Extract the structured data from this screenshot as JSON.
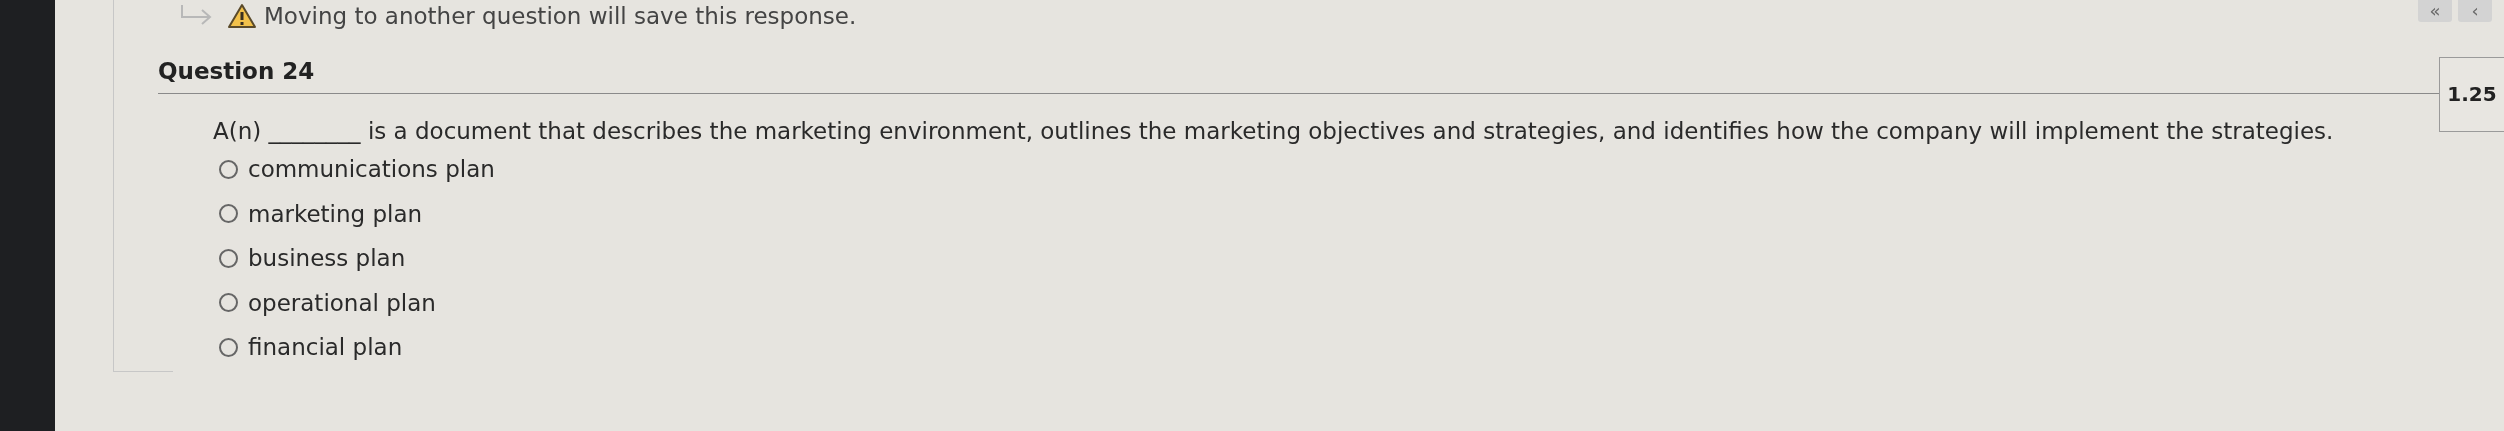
{
  "notice": "Moving to another question will save this response.",
  "nav_buttons": [
    "«",
    "‹"
  ],
  "question": {
    "title": "Question 24",
    "points": "1.25",
    "prompt": "A(n) ________ is a document that describes the marketing environment, outlines the marketing objectives and strategies, and identifies how the company will implement the strategies.",
    "options": [
      {
        "label": "communications plan",
        "selected": false
      },
      {
        "label": "marketing plan",
        "selected": false
      },
      {
        "label": "business plan",
        "selected": false
      },
      {
        "label": "operational plan",
        "selected": false
      },
      {
        "label": "financial plan",
        "selected": false
      }
    ]
  }
}
